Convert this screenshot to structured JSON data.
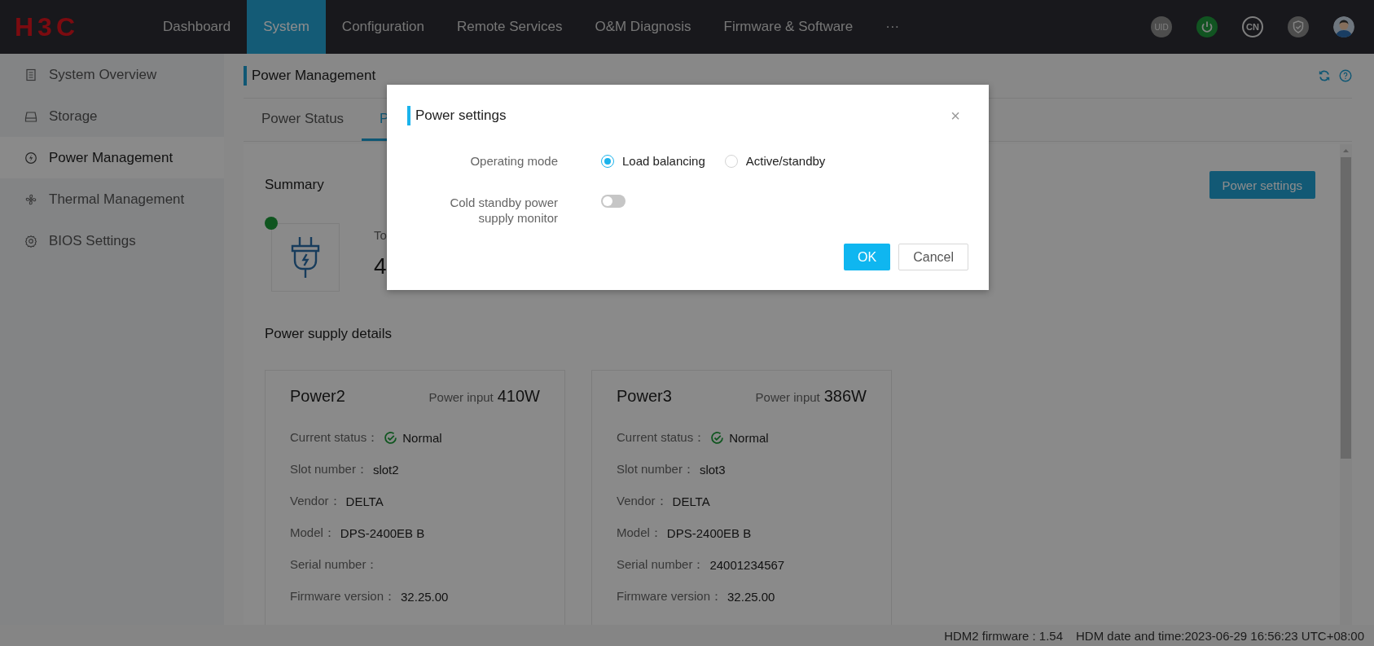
{
  "header": {
    "logo": "H3C",
    "nav": [
      {
        "label": "Dashboard",
        "selected": false
      },
      {
        "label": "System",
        "selected": true
      },
      {
        "label": "Configuration",
        "selected": false
      },
      {
        "label": "Remote Services",
        "selected": false
      },
      {
        "label": "O&M Diagnosis",
        "selected": false
      },
      {
        "label": "Firmware & Software",
        "selected": false
      },
      {
        "label": "···",
        "selected": false
      }
    ],
    "uid_badge": "UID",
    "language_badge": "CN"
  },
  "sidebar": {
    "items": [
      {
        "label": "System Overview",
        "selected": false,
        "kind": "document"
      },
      {
        "label": "Storage",
        "selected": false,
        "kind": "drive"
      },
      {
        "label": "Power Management",
        "selected": true,
        "kind": "power"
      },
      {
        "label": "Thermal Management",
        "selected": false,
        "kind": "fan"
      },
      {
        "label": "BIOS Settings",
        "selected": false,
        "kind": "gear"
      }
    ]
  },
  "page": {
    "title": "Power Management",
    "tabs": [
      {
        "label": "Power Status",
        "selected": false
      },
      {
        "label": "P",
        "selected": true
      }
    ],
    "summary": {
      "heading": "Summary",
      "button": "Power settings",
      "total_label": "To",
      "total_value": "4"
    },
    "details_heading": "Power supply details",
    "cards": [
      {
        "name": "Power2",
        "input_label": "Power input",
        "input_value": "410W",
        "fields": [
          {
            "label": "Current status：",
            "value": "Normal",
            "kind": "status"
          },
          {
            "label": "Slot number：",
            "value": "slot2",
            "kind": "text"
          },
          {
            "label": "Vendor：",
            "value": "DELTA",
            "kind": "text"
          },
          {
            "label": "Model：",
            "value": "DPS-2400EB B",
            "kind": "text"
          },
          {
            "label": "Serial number：",
            "kind": "text"
          },
          {
            "label": "Firmware version：",
            "value": "32.25.00",
            "kind": "text"
          }
        ]
      },
      {
        "name": "Power3",
        "input_label": "Power input",
        "input_value": "386W",
        "fields": [
          {
            "label": "Current status：",
            "value": "Normal",
            "kind": "status"
          },
          {
            "label": "Slot number：",
            "value": "slot3",
            "kind": "text"
          },
          {
            "label": "Vendor：",
            "value": "DELTA",
            "kind": "text"
          },
          {
            "label": "Model：",
            "value": "DPS-2400EB B",
            "kind": "text"
          },
          {
            "label": "Serial number：",
            "value": "24001234567",
            "kind": "text"
          },
          {
            "label": "Firmware version：",
            "value": "32.25.00",
            "kind": "text"
          }
        ]
      }
    ]
  },
  "status_bar": [
    "HDM2 firmware : 1.54",
    "HDM date and time:2023-06-29 16:56:23 UTC+08:00"
  ],
  "dialog": {
    "title": "Power settings",
    "close": "×",
    "operating_mode": {
      "label": "Operating mode",
      "options": [
        {
          "label": "Load balancing",
          "selected": true
        },
        {
          "label": "Active/standby",
          "selected": false
        }
      ]
    },
    "cold_standby": {
      "label": "Cold standby power supply monitor",
      "on": false
    },
    "buttons": [
      {
        "label": "OK",
        "kind": "primary"
      },
      {
        "label": "Cancel",
        "kind": "secondary"
      }
    ]
  }
}
